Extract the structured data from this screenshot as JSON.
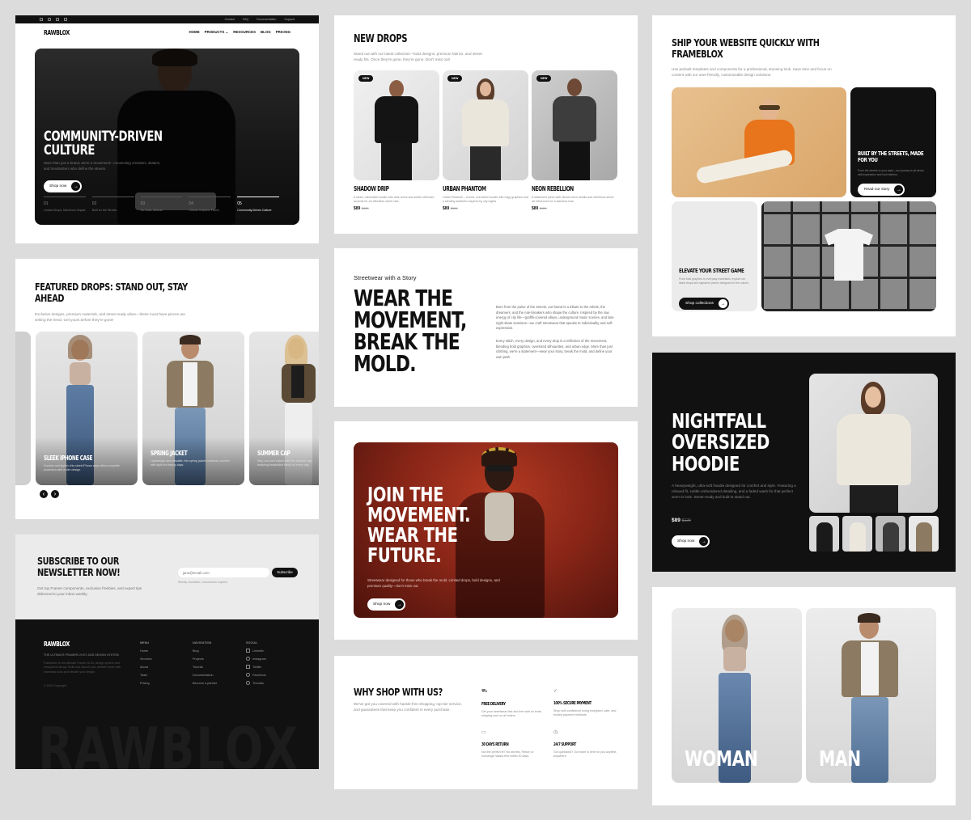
{
  "hero": {
    "topbar_links": [
      "Contact",
      "FAQ",
      "Documentation",
      "Support"
    ],
    "brand": "RAWBLOX",
    "nav": [
      "HOME",
      "PRODUCTS",
      "RESOURCES",
      "BLOG",
      "PRICING"
    ],
    "title_line1": "COMMUNITY-DRIVEN",
    "title_line2": "CULTURE",
    "desc": "More than just a brand, we're a movement—connecting creatives, skaters, and trendsetters who define the streets.",
    "cta": "Shop now",
    "steps": [
      {
        "num": "01",
        "label": "Limited Drops, Maximum Impact"
      },
      {
        "num": "02",
        "label": "Built for the Streets"
      },
      {
        "num": "03",
        "label": "No Basic Attitude"
      },
      {
        "num": "04",
        "label": "Culture Inspired, Future"
      },
      {
        "num": "05",
        "label": "Community-Driven Culture"
      }
    ]
  },
  "featured": {
    "title_line1": "FEATURED DROPS: STAND OUT, STAY",
    "title_line2": "AHEAD",
    "desc": "Exclusive designs, premium materials, and street-ready vibes—these must-have pieces are setting the trend. Get yours before they're gone!",
    "cards": [
      {
        "title": "SLEEK IPHONE CASE",
        "desc": "Durable and stylish, this sleek iPhone case offers complete protection with a slim design."
      },
      {
        "title": "SPRING JACKET",
        "desc": "Lightweight and versatile, this spring jacket combines comfort with style for breezy days."
      },
      {
        "title": "SUMMER CAP",
        "desc": "Stay cool and stylish with this summer cap, featuring breathable fabric for every day."
      }
    ],
    "prev": "‹",
    "next": "›"
  },
  "newsletter": {
    "title_line1": "SUBSCRIBE TO OUR",
    "title_line2": "NEWSLETTER NOW!",
    "desc": "Get top Framer components, exclusive freebies, and expert tips delivered to your inbox weekly.",
    "placeholder": "jane@email.com",
    "button": "Subscribe",
    "note": "Weekly newsletter, Unsubscribe anytime."
  },
  "footer": {
    "brand": "RAWBLOX",
    "tagline": "THE ULTIMATE FRAMER UI KIT AND DESIGN SYSTEM",
    "desc": "Frameblox is the ultimate Framer UI kit, design system and component library. Build and launch your website faster with seamless tools and elevate your design.",
    "copyright": "© 2025 Copyright",
    "menu_title": "MENU",
    "menu": [
      "Home",
      "Services",
      "About",
      "Team",
      "Pricing"
    ],
    "nav_title": "NAVIGATION",
    "nav": [
      "Blog",
      "Projects",
      "Tutorial",
      "Documentation",
      "Become a partner"
    ],
    "social_title": "SOCIAL",
    "social": [
      "LinkedIn",
      "Instagram",
      "Twitter",
      "Facebook",
      "Threads"
    ],
    "watermark": "RAWBLOX"
  },
  "new_drops": {
    "title": "NEW DROPS",
    "desc": "Stand out with our latest collection—bold designs, premium fabrics, and street-ready fits. Once they're gone, they're gone. Don't miss out!",
    "badge": "NEW",
    "products": [
      {
        "name": "SHADOW DRIP",
        "desc": "A sleek, minimalist hoodie with dark tones and subtle reflective accents for an effortless street vibe.",
        "price": "$89",
        "old_price": "$120"
      },
      {
        "name": "URBAN PHANTOM",
        "desc": "Urban Phantom – A bold, oversized hoodie with edgy graphics and a stealthy aesthetic inspired by city nights.",
        "price": "$89",
        "old_price": "$120"
      },
      {
        "name": "NEON REBELLION",
        "desc": "A statement piece with vibrant neon details and rebellious street art influences for a standout look.",
        "price": "$89",
        "old_price": "$120"
      }
    ]
  },
  "story": {
    "eyebrow": "Streetwear with a Story",
    "title": [
      "WEAR THE",
      "MOVEMENT,",
      "BREAK THE",
      "MOLD."
    ],
    "para1": "Born from the pulse of the streets, our brand is a tribute to the rebels, the dreamers, and the rule-breakers who shape the culture. Inspired by the raw energy of city life—graffiti-covered alleys, underground music scenes, and late-night skate sessions—we craft streetwear that speaks to individuality and self-expression.",
    "para2": "Every stitch, every design, and every drop is a reflection of the movement, blending bold graphics, oversized silhouettes, and urban edge. More than just clothing, we're a statement—wear your story, break the mold, and define your own path."
  },
  "join": {
    "title": [
      "JOIN THE",
      "MOVEMENT.",
      "WEAR THE",
      "FUTURE."
    ],
    "desc": "Streetwear designed for those who break the mold. Limited drops, bold designs, and premium quality—don't miss out.",
    "cta": "Shop now"
  },
  "why": {
    "title": "WHY SHOP WITH US?",
    "desc": "We've got you covered with hassle-free shopping, top-tier service, and guarantees that keep you confident in every purchase.",
    "features": [
      {
        "icon": "⛟",
        "title": "FREE DELIVERY",
        "desc": "Get your streetwear fast and free with no extra shipping cost on all orders."
      },
      {
        "icon": "✓",
        "title": "100% SECURE PAYMENT",
        "desc": "Shop with confidence using encrypted, safe, and trusted payment methods."
      },
      {
        "icon": "▭",
        "title": "30 DAYS RETURN",
        "desc": "Not the perfect fit? No worries. Return or exchange hassle-free within 30 days."
      },
      {
        "icon": "◷",
        "title": "24/7 SUPPORT",
        "desc": "Got questions? Our team is here for you anytime, anywhere."
      }
    ]
  },
  "ship": {
    "title_line1": "SHIP YOUR WEBSITE QUICKLY WITH",
    "title_line2": "FRAMEBLOX",
    "desc": "Use prebuilt templates and components for a professional, stunning look. Save time and focus on content with our user-friendly, customizable design solutions.",
    "built_title": "BUILT BY THE STREETS, MADE FOR YOU",
    "built_desc": "From the streets to your style—our journey is all about self-expression and bold fashion.",
    "built_cta": "Read our story",
    "elevate_title": "ELEVATE YOUR STREET GAME",
    "elevate_desc": "From bold graphics to everyday essentials, explore our latest drops and signature pieces designed for the culture.",
    "elevate_cta": "Shop collections"
  },
  "nightfall": {
    "title": [
      "NIGHTFALL",
      "OVERSIZED",
      "HOODIE"
    ],
    "desc": "A heavyweight, ultra-soft hoodie designed for comfort and style. Featuring a relaxed fit, subtle embroidered detailing, and a faded wash for that perfect worn-in look. Street-ready and built to stand out.",
    "price": "$89",
    "old_price": "$120",
    "cta": "Shop now"
  },
  "gender": {
    "woman": "WOMAN",
    "man": "MAN"
  },
  "colors": {
    "dark": "#111111",
    "accent_red": "#8a2618",
    "orange": "#e8741c"
  }
}
